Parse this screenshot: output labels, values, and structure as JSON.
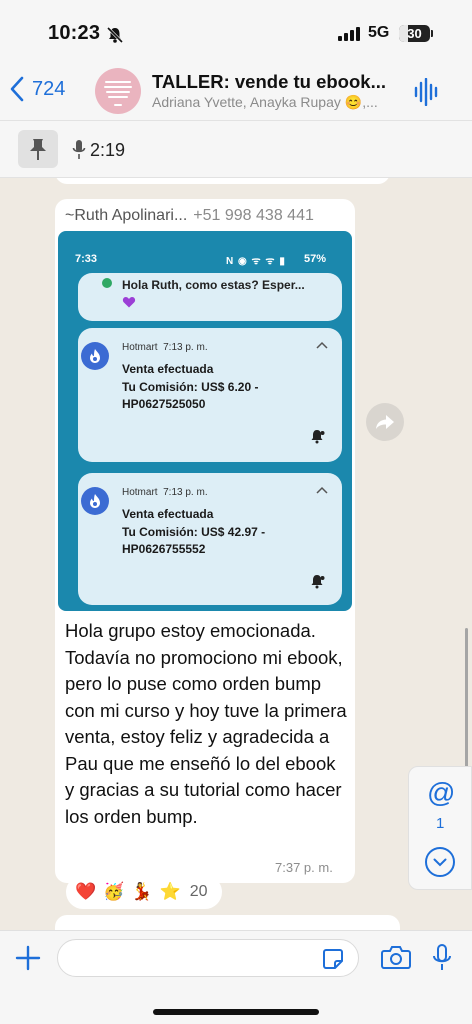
{
  "status_bar": {
    "time": "10:23",
    "network": "5G",
    "battery": "30",
    "battery_level": 0.3
  },
  "header": {
    "back_count": "724",
    "title": "TALLER: vende tu ebook...",
    "subtitle": "Adriana Yvette, Anayka Rupay 😊,...",
    "avatar_icon": "group-avatar"
  },
  "pinned": {
    "duration": "2:19"
  },
  "message": {
    "sender_name": "~Ruth Apolinari...",
    "sender_phone": "+51 998 438 441",
    "screenshot": {
      "time": "7:33",
      "status_icons": "N ◉ ᯤ ᯤ ▮",
      "battery": "57%",
      "first_notification": "Hola Ruth, como estas? Esper...",
      "notifications": [
        {
          "app": "Hotmart",
          "time": "7:13 p. m.",
          "title": "Venta efectuada",
          "line1": "Tu Comisión: US$ 6.20 -",
          "line2": "HP0627525050"
        },
        {
          "app": "Hotmart",
          "time": "7:13 p. m.",
          "title": "Venta efectuada",
          "line1": "Tu Comisión: US$ 42.97 -",
          "line2": "HP0626755552"
        }
      ]
    },
    "text": "Hola grupo estoy emocionada. Todavía no promociono mi ebook, pero lo puse como orden bump con mi curso y hoy tuve la primera venta, estoy feliz y agradecida a Pau que me enseñó lo del ebook y gracias a su tutorial como hacer los orden bump.",
    "time": "7:37 p. m.",
    "reactions": [
      "❤️",
      "🥳",
      "💃",
      "⭐"
    ],
    "reaction_count": "20"
  },
  "side_panel": {
    "mention_symbol": "@",
    "mention_count": "1"
  },
  "colors": {
    "accent": "#1e6fd9",
    "chat_bg": "#efeae2",
    "bubble": "#ffffff",
    "screenshot_bg": "#1b88ad",
    "notification_card": "#ddeef6",
    "hotmart_icon": "#3b6bd3"
  }
}
